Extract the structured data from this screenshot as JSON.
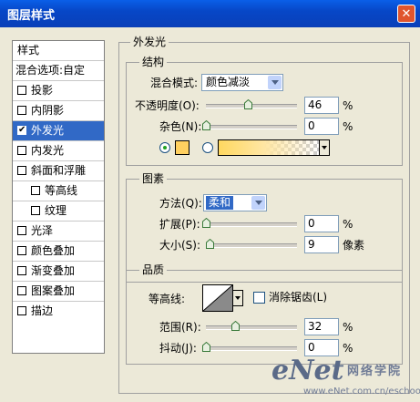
{
  "window": {
    "title": "图层样式"
  },
  "styles_list": {
    "header": "样式",
    "blend_options": "混合选项:自定",
    "items": [
      {
        "label": "投影",
        "checked": false
      },
      {
        "label": "内阴影",
        "checked": false
      },
      {
        "label": "外发光",
        "checked": true
      },
      {
        "label": "内发光",
        "checked": false
      },
      {
        "label": "斜面和浮雕",
        "checked": false
      },
      {
        "label": "等高线",
        "checked": false
      },
      {
        "label": "纹理",
        "checked": false
      },
      {
        "label": "光泽",
        "checked": false
      },
      {
        "label": "颜色叠加",
        "checked": false
      },
      {
        "label": "渐变叠加",
        "checked": false
      },
      {
        "label": "图案叠加",
        "checked": false
      },
      {
        "label": "描边",
        "checked": false
      }
    ]
  },
  "outer_glow": {
    "title": "外发光",
    "structure": {
      "title": "结构",
      "blend_mode_label": "混合模式:",
      "blend_mode_value": "颜色减淡",
      "opacity_label": "不透明度(O):",
      "opacity_value": "46",
      "opacity_unit": "%",
      "noise_label": "杂色(N):",
      "noise_value": "0",
      "noise_unit": "%",
      "glow_color": "#ffd060",
      "color_mode": "solid"
    },
    "elements": {
      "title": "图素",
      "technique_label": "方法(Q):",
      "technique_value": "柔和",
      "spread_label": "扩展(P):",
      "spread_value": "0",
      "spread_unit": "%",
      "size_label": "大小(S):",
      "size_value": "9",
      "size_unit": "像素"
    },
    "quality": {
      "title": "品质",
      "contour_label": "等高线:",
      "antialias_label": "消除锯齿(L)",
      "antialias_checked": false,
      "range_label": "范围(R):",
      "range_value": "32",
      "range_unit": "%",
      "jitter_label": "抖动(J):",
      "jitter_value": "0",
      "jitter_unit": "%"
    }
  },
  "watermark": {
    "logo": "eNet",
    "cn_text": "网络学院",
    "url": "www.eNet.com.cn/eschool"
  }
}
